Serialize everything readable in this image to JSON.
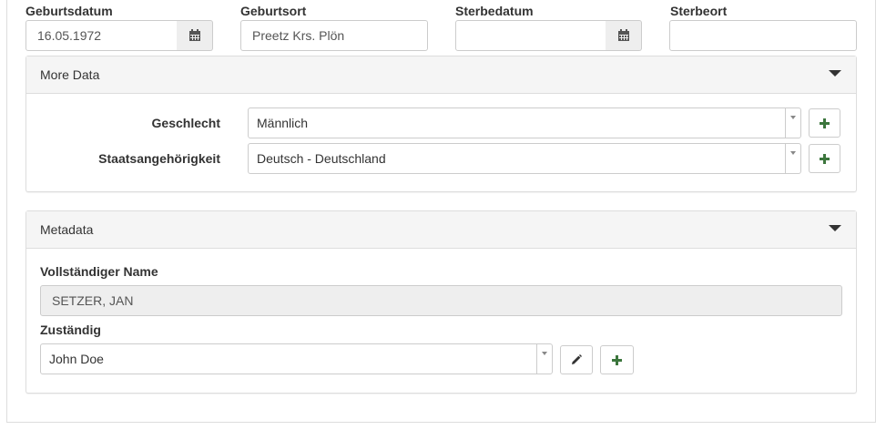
{
  "dates": {
    "birth_date_label": "Geburtsdatum",
    "birth_date_value": "16.05.1972",
    "birth_place_label": "Geburtsort",
    "birth_place_value": "Preetz Krs. Plön",
    "death_date_label": "Sterbedatum",
    "death_date_value": "",
    "death_place_label": "Sterbeort",
    "death_place_value": ""
  },
  "more_data": {
    "title": "More Data",
    "gender_label": "Geschlecht",
    "gender_value": "Männlich",
    "nationality_label": "Staatsangehörigkeit",
    "nationality_value": "Deutsch - Deutschland"
  },
  "metadata": {
    "title": "Metadata",
    "full_name_label": "Vollständiger Name",
    "full_name_value": "SETZER, JAN",
    "responsible_label": "Zuständig",
    "responsible_value": "John Doe"
  },
  "icons": {
    "calendar": "calendar-icon",
    "plus": "plus-icon",
    "pencil": "pencil-icon",
    "caret": "caret-down-icon"
  },
  "colors": {
    "plus": "#3c763d",
    "panel_heading": "#f5f5f5",
    "readonly": "#eeeeee"
  }
}
